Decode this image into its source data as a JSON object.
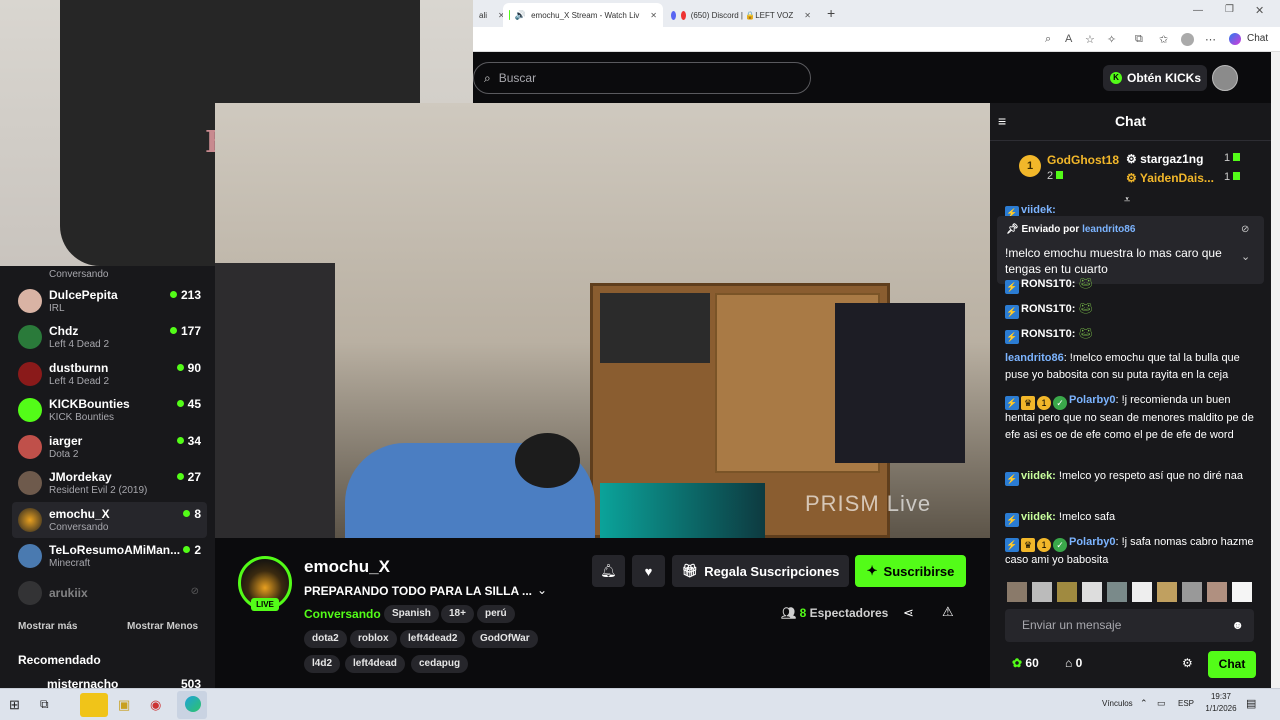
{
  "browser": {
    "tabs": [
      {
        "label": "ali"
      },
      {
        "label": "emochu_X Stream - Watch Liv"
      },
      {
        "label": "(650) Discord | 🔒LEFT VOZ"
      }
    ],
    "copilot_label": "Chat"
  },
  "header": {
    "search_placeholder": "Buscar",
    "kicks_label": "Obtén KICKs"
  },
  "sidebar": {
    "channels": [
      {
        "name": "",
        "category": "Conversando",
        "viewers": ""
      },
      {
        "name": "DulcePepita",
        "category": "IRL",
        "viewers": "213"
      },
      {
        "name": "Chdz",
        "category": "Left 4 Dead 2",
        "viewers": "177"
      },
      {
        "name": "dustburnn",
        "category": "Left 4 Dead 2",
        "viewers": "90"
      },
      {
        "name": "KICKBounties",
        "category": "KICK Bounties",
        "viewers": "45"
      },
      {
        "name": "iarger",
        "category": "Dota 2",
        "viewers": "34"
      },
      {
        "name": "JMordekay",
        "category": "Resident Evil 2 (2019)",
        "viewers": "27"
      },
      {
        "name": "emochu_X",
        "category": "Conversando",
        "viewers": "8"
      },
      {
        "name": "TeLoResumoAMiMan...",
        "category": "Minecraft",
        "viewers": "2"
      },
      {
        "name": "arukiix",
        "category": "",
        "viewers": ""
      }
    ],
    "show_more": "Mostrar más",
    "show_less": "Mostrar Menos",
    "recommended": "Recomendado",
    "recommended_first": {
      "name": "misternacho",
      "viewers": "503"
    }
  },
  "video": {
    "watermark": "PRISM Live"
  },
  "stream": {
    "streamer": "emochu_X",
    "live": "LIVE",
    "title": "PREPARANDO TODO PARA LA SILLA ...",
    "category": "Conversando",
    "tags": [
      "Spanish",
      "18+",
      "perú",
      "dota2",
      "roblox",
      "left4dead2",
      "GodOfWar",
      "l4d2",
      "left4dead",
      "cedapug"
    ],
    "gift_label": "Regala Suscripciones",
    "subscribe_label": "Suscribirse",
    "viewers_count": "8",
    "viewers_label": "Espectadores"
  },
  "chat": {
    "title": "Chat",
    "leaderboard": [
      {
        "rank": "1",
        "name": "GodGhost18",
        "count": "2"
      },
      {
        "name": "stargaz1ng",
        "count": "1"
      },
      {
        "name": "YaidenDais...",
        "count": "1"
      }
    ],
    "pinned": {
      "sent_by_label": "Enviado por",
      "sent_by": "leandrito86",
      "text": "!melco emochu muestra lo mas caro que tengas en tu cuarto"
    },
    "partial_top": "viidek:",
    "messages": [
      {
        "user": "RONS1T0:",
        "text": ""
      },
      {
        "user": "RONS1T0:",
        "text": ""
      },
      {
        "user": "RONS1T0:",
        "text": ""
      },
      {
        "user": "leandrito86",
        "text": ": !melco emochu que tal la bulla que puse yo babosita con su puta rayita en la ceja"
      },
      {
        "user": "Polarby0",
        "text": ": !j recomienda un buen hentai pero que no sean de menores maldito pe de efe asi es oe de efe como el pe de efe de word"
      },
      {
        "user": "viidek:",
        "text": " !melco yo respeto así que no diré naa"
      },
      {
        "user": "viidek:",
        "text": " !melco safa"
      },
      {
        "user": "Polarby0",
        "text": ": !j safa nomas cabro hazme caso ami yo babosita"
      }
    ],
    "input_placeholder": "Enviar un mensaje",
    "points": "60",
    "store_count": "0",
    "send_label": "Chat"
  },
  "taskbar": {
    "links_label": "Vínculos",
    "lang": "ESP",
    "time": "19:37",
    "date": "1/1/2026"
  },
  "colors": {
    "kick_green": "#53fc18",
    "panel": "#18181b",
    "background": "#0b0b0d"
  }
}
